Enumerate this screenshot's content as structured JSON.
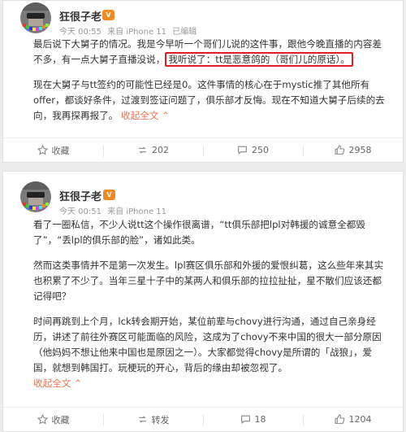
{
  "posts": [
    {
      "user": {
        "name": "狂很子老",
        "badge": "V",
        "accent": "#f08a24"
      },
      "meta": {
        "time": "今天 00:55",
        "source": "来自 iPhone 11",
        "edited": "已编辑"
      },
      "body": {
        "p1_before": "最后说下大舅子的情况。我是今早听一个哥们儿说的这件事，跟他今晚直播的内容差不多，有一点大舅子直播没说，",
        "p1_highlight": "我听说了：tt是恶意鸽的（哥们儿的原话）。",
        "p2": "现在大舅子与tt签约的可能性已经是0。这件事情的核心在于mystic推了其他所有offer，都谈好条件，过渡到签证问题了，俱乐部才反悔。现在不知道大舅子后续的去向，我再探再报了。",
        "collapse": "收起全文",
        "collapse_arrow": "⌃"
      },
      "actions": {
        "favorite": "收藏",
        "repost": "202",
        "comment": "250",
        "like": "2958"
      }
    },
    {
      "user": {
        "name": "狂很子老",
        "badge": "V",
        "accent": "#f08a24"
      },
      "meta": {
        "time": "今天 00:51",
        "source": "来自 iPhone 11"
      },
      "body": {
        "p1": "看了一圈私信，不少人说tt这个操作很离谱，“tt俱乐部把lpl对韩援的诚意全都毁了”，“丢lpl的俱乐部的脸”，诸如此类。",
        "p2": "然而这类事情并不是第一次发生。lpl赛区俱乐部和外援的爱恨纠葛，这么些年来其实也积累了不少了。当年三星十子中的某两人和俱乐部的拉拉扯扯，星不散们应该还都记得吧？",
        "p3": "时间再跳到上个月，lck转会期开始，某位前辈与chovy进行沟通，通过自己亲身经历，讲述了前往外赛区可能面临的风险，这成为了chovy不来中国的很大一部分原因（他妈妈不想让他来中国也是原因之一）。大家都觉得chovy是所谓的「战狼」，爱国，就想到韩国打。玩梗玩的开心，背后的缘由却被忽视了。",
        "collapse": "收起全文",
        "collapse_arrow": "⌃"
      },
      "actions": {
        "favorite": "收藏",
        "repost": "转发",
        "comment": "18",
        "like": "1204"
      }
    }
  ]
}
